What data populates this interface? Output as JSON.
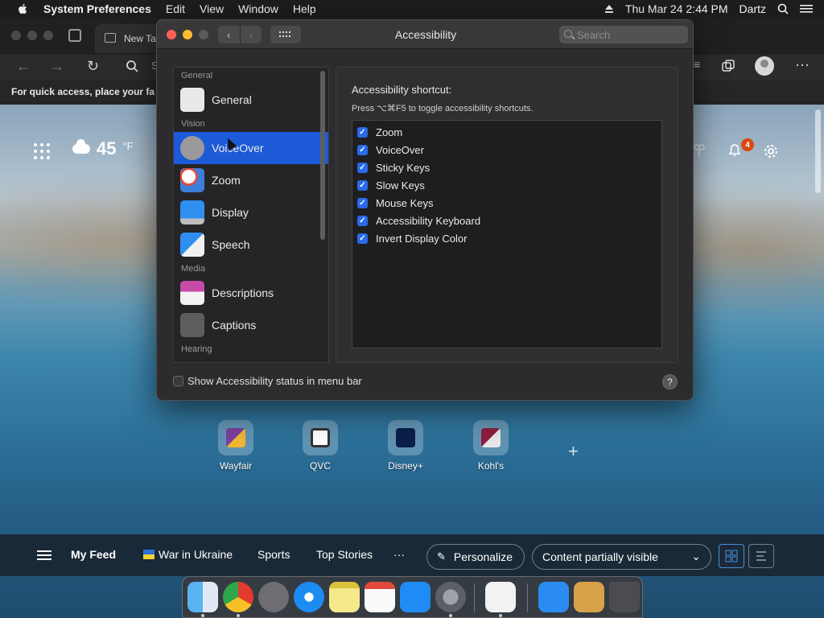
{
  "menubar": {
    "app_name": "System Preferences",
    "menus": [
      "Edit",
      "View",
      "Window",
      "Help"
    ],
    "clock": "Thu Mar 24  2:44 PM",
    "user": "Dartz"
  },
  "browser": {
    "tab_title": "New Ta",
    "address_partial": "S",
    "favorites_hint": "For quick access, place your fa"
  },
  "newtab": {
    "temperature": "45",
    "temp_unit": "°F",
    "notification_count": "4",
    "quick_links": [
      {
        "label": "Wayfair"
      },
      {
        "label": "QVC"
      },
      {
        "label": "Disney+"
      },
      {
        "label": "Kohl's"
      }
    ],
    "add_symbol": "+"
  },
  "feed": {
    "items": [
      "My Feed",
      "War in Ukraine",
      "Sports",
      "Top Stories"
    ],
    "more": "···",
    "personalize": "Personalize",
    "visibility": "Content partially visible"
  },
  "window": {
    "title": "Accessibility",
    "search_placeholder": "Search",
    "sidebar": [
      {
        "type": "header",
        "label": "General"
      },
      {
        "type": "item",
        "label": "General",
        "icon": "general-icon",
        "selected": false
      },
      {
        "type": "header",
        "label": "Vision"
      },
      {
        "type": "item",
        "label": "VoiceOver",
        "icon": "voiceover-icon",
        "selected": true
      },
      {
        "type": "item",
        "label": "Zoom",
        "icon": "zoom-icon",
        "selected": false
      },
      {
        "type": "item",
        "label": "Display",
        "icon": "display-icon",
        "selected": false
      },
      {
        "type": "item",
        "label": "Speech",
        "icon": "speech-icon",
        "selected": false
      },
      {
        "type": "header",
        "label": "Media"
      },
      {
        "type": "item",
        "label": "Descriptions",
        "icon": "descriptions-icon",
        "selected": false
      },
      {
        "type": "item",
        "label": "Captions",
        "icon": "captions-icon",
        "selected": false
      },
      {
        "type": "header",
        "label": "Hearing"
      }
    ],
    "panel": {
      "heading": "Accessibility shortcut:",
      "subheading": "Press ⌥⌘F5 to toggle accessibility shortcuts.",
      "options": [
        {
          "label": "Zoom",
          "checked": true
        },
        {
          "label": "VoiceOver",
          "checked": true
        },
        {
          "label": "Sticky Keys",
          "checked": true
        },
        {
          "label": "Slow Keys",
          "checked": true
        },
        {
          "label": "Mouse Keys",
          "checked": true
        },
        {
          "label": "Accessibility Keyboard",
          "checked": true
        },
        {
          "label": "Invert Display Color",
          "checked": true
        }
      ]
    },
    "footer_checkbox": "Show Accessibility status in menu bar",
    "footer_checked": false,
    "help_label": "?"
  },
  "colors": {
    "selection": "#1d5ad8",
    "checkbox": "#2a6ae8",
    "close": "#fe5f57",
    "minimize": "#febc2e"
  }
}
